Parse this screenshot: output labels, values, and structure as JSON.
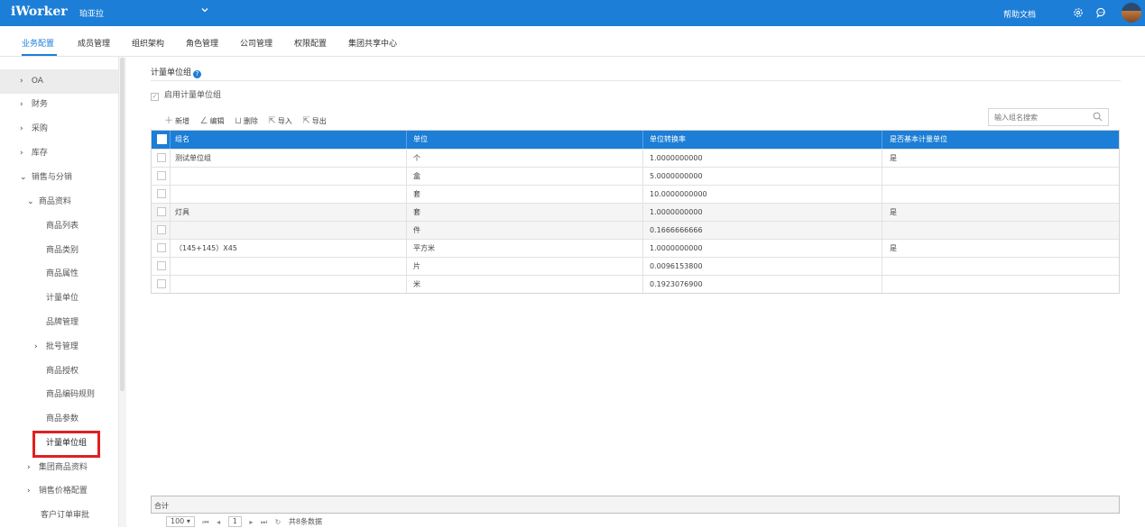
{
  "app": {
    "brand": "iWorker",
    "org_name": "珀亚拉",
    "help_label": "帮助文档",
    "settings_icon": "gear-icon",
    "chat_icon": "chat-icon",
    "accent_color": "#1c7ed6"
  },
  "nav": {
    "items": [
      {
        "label": "业务配置"
      },
      {
        "label": "成员管理"
      },
      {
        "label": "组织架构"
      },
      {
        "label": "角色管理"
      },
      {
        "label": "公司管理"
      },
      {
        "label": "权限配置"
      },
      {
        "label": "集团共享中心"
      }
    ],
    "active_index": 0
  },
  "sidebar": {
    "items": [
      {
        "label": "OA",
        "arrow": "›"
      },
      {
        "label": "财务",
        "arrow": "›"
      },
      {
        "label": "采购",
        "arrow": "›"
      },
      {
        "label": "库存",
        "arrow": "›"
      },
      {
        "label": "销售与分销",
        "arrow": "⌄"
      },
      {
        "label": "商品资料",
        "arrow": "⌄"
      },
      {
        "label": "商品列表"
      },
      {
        "label": "商品类别"
      },
      {
        "label": "商品属性"
      },
      {
        "label": "计量单位"
      },
      {
        "label": "品牌管理"
      },
      {
        "label": "批号管理",
        "arrow": "›"
      },
      {
        "label": "商品授权"
      },
      {
        "label": "商品编码规则"
      },
      {
        "label": "商品参数"
      },
      {
        "label": "计量单位组"
      },
      {
        "label": "集团商品资料",
        "arrow": "›"
      },
      {
        "label": "销售价格配置",
        "arrow": "›"
      },
      {
        "label": "客户订单审批"
      }
    ],
    "active_index": 15
  },
  "page": {
    "title": "计量单位组",
    "enable_label": "启用计量单位组"
  },
  "toolbar": {
    "add": "新增",
    "edit": "编辑",
    "delete": "删除",
    "import": "导入",
    "export": "导出"
  },
  "search": {
    "placeholder": "输入组名搜索"
  },
  "table": {
    "headers": [
      "组名",
      "单位",
      "单位转换率",
      "是否基本计量单位"
    ],
    "rows": [
      {
        "group": "测试单位组",
        "unit": "个",
        "rate": "1.0000000000",
        "base": "是"
      },
      {
        "group": "",
        "unit": "盒",
        "rate": "5.0000000000",
        "base": ""
      },
      {
        "group": "",
        "unit": "套",
        "rate": "10.0000000000",
        "base": ""
      },
      {
        "group": "灯具",
        "unit": "套",
        "rate": "1.0000000000",
        "base": "是"
      },
      {
        "group": "",
        "unit": "件",
        "rate": "0.1666666666",
        "base": ""
      },
      {
        "group": "（145+145）X45",
        "unit": "平方米",
        "rate": "1.0000000000",
        "base": "是"
      },
      {
        "group": "",
        "unit": "片",
        "rate": "0.0096153800",
        "base": ""
      },
      {
        "group": "",
        "unit": "米",
        "rate": "0.1923076900",
        "base": ""
      }
    ]
  },
  "footer": {
    "total_label": "合计"
  },
  "pager": {
    "page_size": "100",
    "current_page": "1",
    "summary": "共8条数据"
  }
}
